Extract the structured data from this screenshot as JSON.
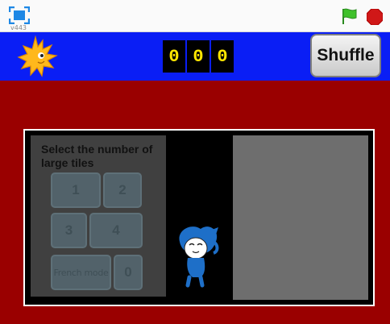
{
  "toolbar": {
    "version": "v443",
    "fullscreen_icon": "fullscreen-icon",
    "flag_icon": "green-flag-icon",
    "stop_icon": "stop-icon"
  },
  "header": {
    "counter_digits": [
      "0",
      "0",
      "0"
    ],
    "shuffle_label": "Shuffle"
  },
  "panel": {
    "title": "Select the number of large tiles",
    "tiles": [
      "1",
      "2",
      "3",
      "4"
    ],
    "french_mode_label": "French mode",
    "french_mode_value": "0"
  },
  "colors": {
    "stage_background": "#9a0000",
    "header_background": "#0a1ef5",
    "digit_color": "#ffe600"
  }
}
